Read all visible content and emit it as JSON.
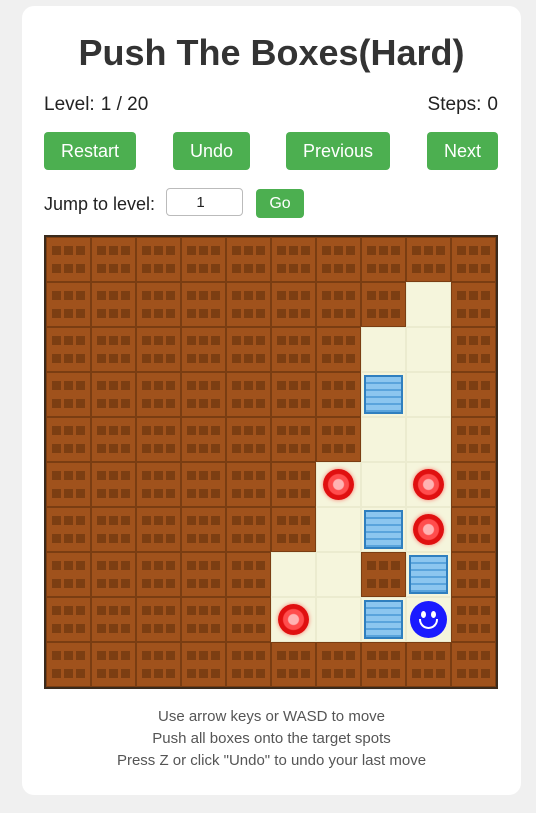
{
  "title": "Push The Boxes(Hard)",
  "level": {
    "label": "Level:",
    "current": "1",
    "separator": "/",
    "total": "20"
  },
  "steps": {
    "label": "Steps:",
    "value": "0"
  },
  "buttons": {
    "restart": "Restart",
    "undo": "Undo",
    "previous": "Previous",
    "next": "Next"
  },
  "jump": {
    "label": "Jump to level:",
    "value": "1",
    "go": "Go"
  },
  "colors": {
    "button": "#4caf50",
    "wall": "#a0521c",
    "floor": "#f5f5dc",
    "box": "#8cc6ef",
    "target": "#ff3333",
    "player": "#1a1aff"
  },
  "map": [
    "##########",
    "########.#",
    "#######..#",
    "#######$.#",
    "#######..#",
    "######*.*#",
    "######.$*#",
    "#####..#$#",
    "#####*.$@#",
    "##########"
  ],
  "legend": {
    "#": "wall-icon",
    ".": "floor",
    "$": "box-icon",
    "*": "target-icon",
    "@": "player-smiley-icon"
  },
  "instructions": [
    "Use arrow keys or WASD to move",
    "Push all boxes onto the target spots",
    "Press Z or click \"Undo\" to undo your last move"
  ]
}
